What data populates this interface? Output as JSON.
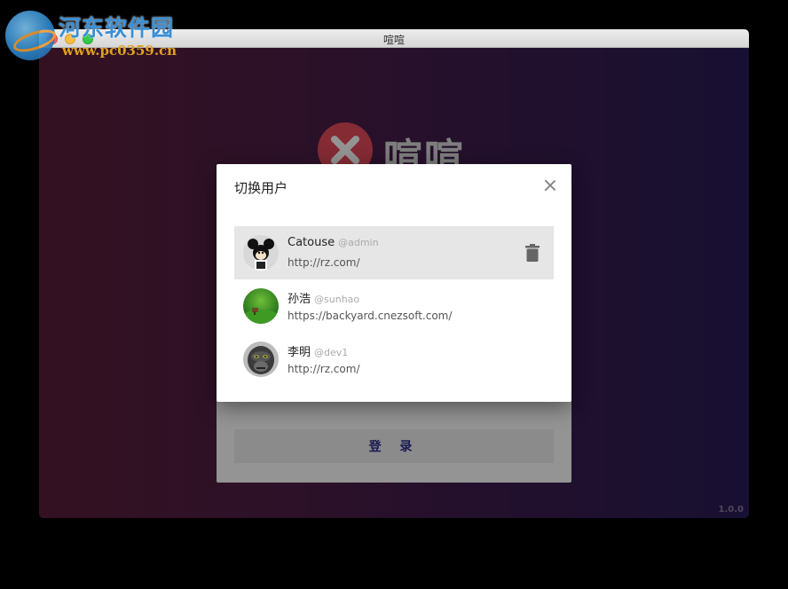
{
  "watermark": {
    "title": "河东软件园",
    "url": "www.pc0359.cn"
  },
  "window": {
    "title": "喧喧"
  },
  "brand": {
    "name": "喧喧",
    "accent": "#e44a5a"
  },
  "login": {
    "button_label": "登 录"
  },
  "version": "1.0.0",
  "dialog": {
    "title": "切换用户",
    "close_icon": "close-icon",
    "users": [
      {
        "name": "Catouse",
        "handle": "@admin",
        "url": "http://rz.com/",
        "avatar": "mickey-avatar",
        "active": true,
        "action_icon": "trash-icon"
      },
      {
        "name": "孙浩",
        "handle": "@sunhao",
        "url": "https://backyard.cnezsoft.com/",
        "avatar": "grass-avatar",
        "active": false
      },
      {
        "name": "李明",
        "handle": "@dev1",
        "url": "http://rz.com/",
        "avatar": "gorilla-avatar",
        "active": false
      }
    ]
  },
  "colors": {
    "gradient_left": "#5a1e3a",
    "gradient_right": "#291c56",
    "active_row": "#e6e6e6"
  }
}
